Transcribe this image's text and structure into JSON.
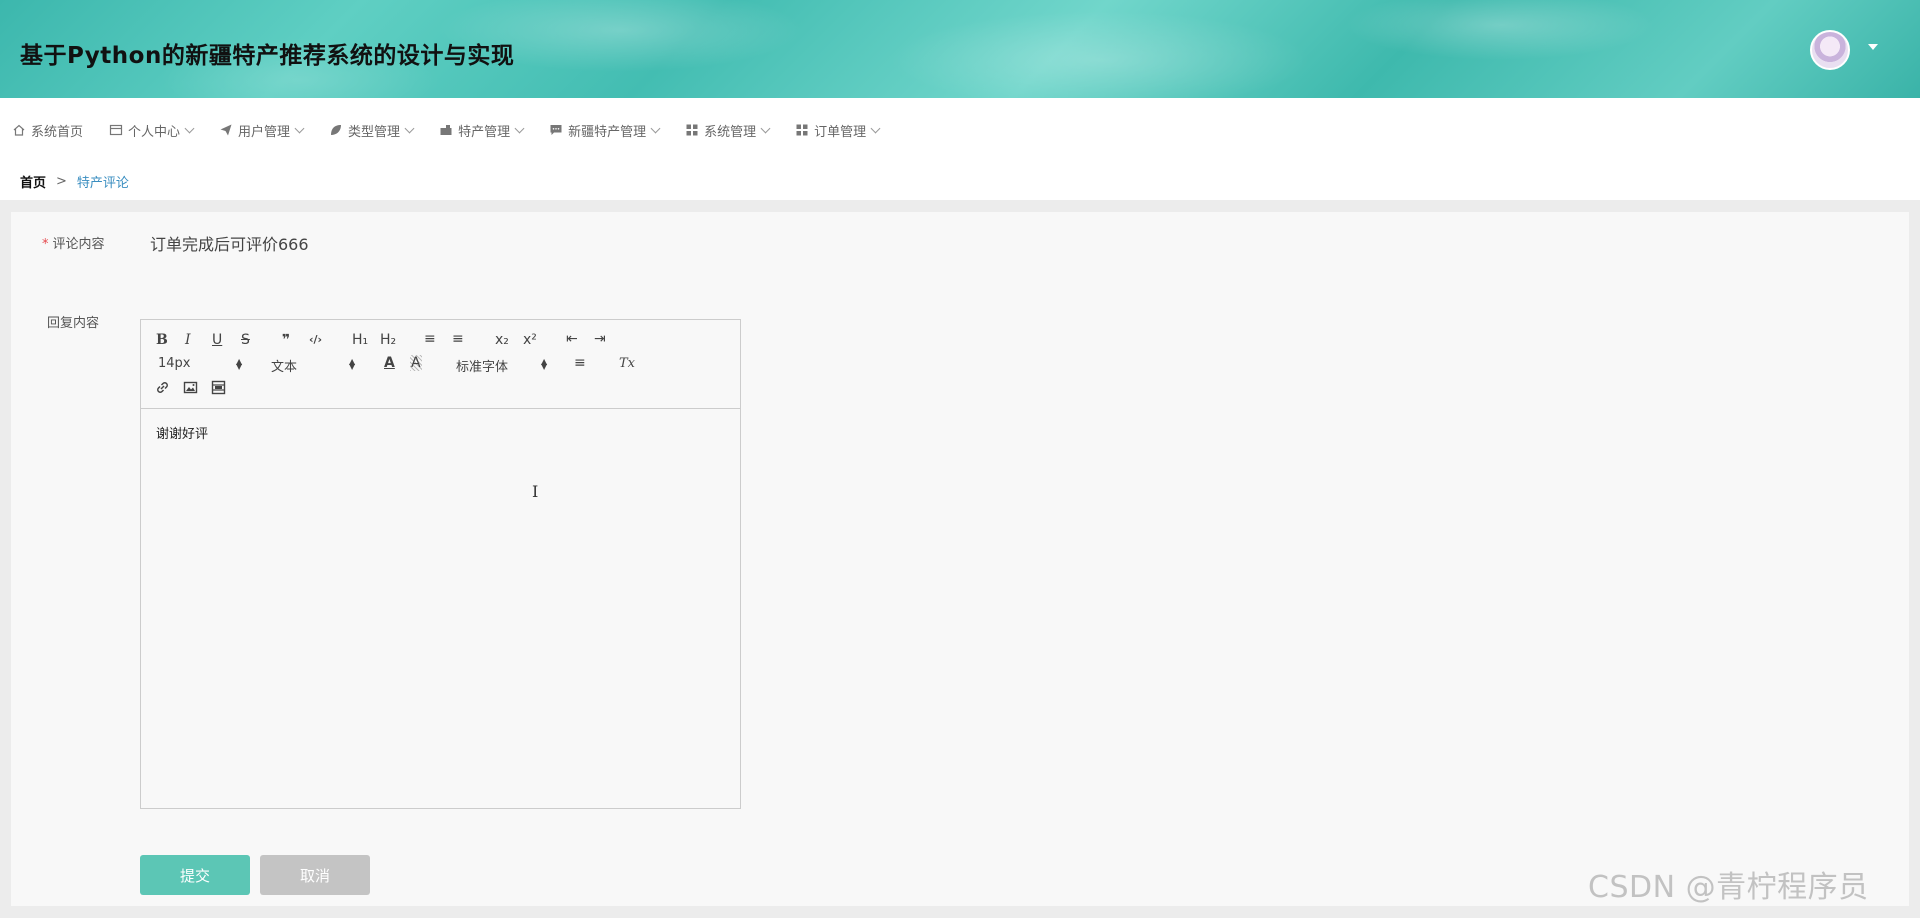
{
  "header": {
    "title": "基于Python的新疆特产推荐系统的设计与实现"
  },
  "nav": {
    "items": [
      {
        "label": "系统首页",
        "icon": "home-icon",
        "dropdown": false
      },
      {
        "label": "个人中心",
        "icon": "profile-icon",
        "dropdown": true
      },
      {
        "label": "用户管理",
        "icon": "send-icon",
        "dropdown": true
      },
      {
        "label": "类型管理",
        "icon": "leaf-icon",
        "dropdown": true
      },
      {
        "label": "特产管理",
        "icon": "briefcase-icon",
        "dropdown": true
      },
      {
        "label": "新疆特产管理",
        "icon": "chat-icon",
        "dropdown": true
      },
      {
        "label": "系统管理",
        "icon": "grid-icon",
        "dropdown": true
      },
      {
        "label": "订单管理",
        "icon": "grid-icon",
        "dropdown": true
      }
    ]
  },
  "breadcrumb": {
    "home": "首页",
    "separator": ">",
    "current": "特产评论"
  },
  "form": {
    "comment_label": "评论内容",
    "required_mark": "*",
    "comment_value": "订单完成后可评价666",
    "reply_label": "回复内容",
    "reply_value": "谢谢好评"
  },
  "editor": {
    "toolbar": {
      "bold": "B",
      "italic": "I",
      "underline": "U",
      "strike": "S",
      "quote": "❞",
      "code": "‹/›",
      "h1": "H₁",
      "h2": "H₂",
      "ordered": "≡",
      "bullet": "≡",
      "sub": "x₂",
      "sup": "x²",
      "outdent": "⇤",
      "indent": "⇥",
      "size": "14px",
      "block": "文本",
      "font": "标准字体",
      "color": "A",
      "bg": "A",
      "align": "≡",
      "clear": "Tx"
    }
  },
  "buttons": {
    "submit": "提交",
    "cancel": "取消"
  },
  "watermark": "CSDN @青柠程序员",
  "colors": {
    "accent": "#5cc6b5",
    "header": "#45bdb1",
    "link": "#3a8ec0",
    "required": "#e5484d"
  }
}
